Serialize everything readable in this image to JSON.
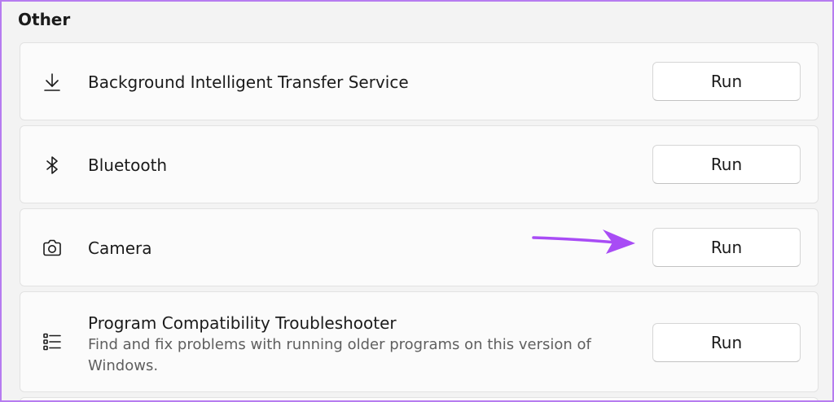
{
  "section": {
    "title": "Other"
  },
  "items": [
    {
      "icon": "download-icon",
      "label": "Background Intelligent Transfer Service",
      "button_label": "Run"
    },
    {
      "icon": "bluetooth-icon",
      "label": "Bluetooth",
      "button_label": "Run"
    },
    {
      "icon": "camera-icon",
      "label": "Camera",
      "button_label": "Run"
    },
    {
      "icon": "list-icon",
      "label": "Program Compatibility Troubleshooter",
      "description": "Find and fix problems with running older programs on this version of Windows.",
      "button_label": "Run"
    }
  ],
  "colors": {
    "frame_border": "#b67cf0",
    "annotation_arrow": "#a84cf5",
    "background": "#f3f3f3",
    "card": "#fbfbfb"
  }
}
